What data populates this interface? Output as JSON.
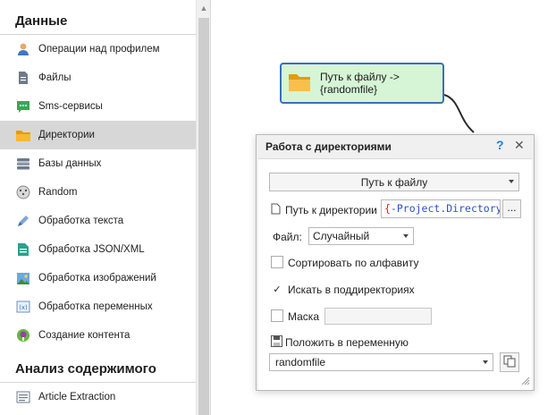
{
  "sidebar": {
    "section_data": "Данные",
    "section_analysis": "Анализ содержимого",
    "items": [
      {
        "label": "Операции над профилем",
        "icon": "user-icon"
      },
      {
        "label": "Файлы",
        "icon": "file-icon"
      },
      {
        "label": "Sms-сервисы",
        "icon": "sms-icon"
      },
      {
        "label": "Директории",
        "icon": "folder-icon",
        "active": true
      },
      {
        "label": "Базы данных",
        "icon": "database-icon"
      },
      {
        "label": "Random",
        "icon": "dice-icon"
      },
      {
        "label": "Обработка текста",
        "icon": "text-processing-icon"
      },
      {
        "label": "Обработка JSON/XML",
        "icon": "json-xml-icon"
      },
      {
        "label": "Обработка изображений",
        "icon": "image-icon"
      },
      {
        "label": "Обработка переменных",
        "icon": "variable-icon"
      },
      {
        "label": "Создание контента",
        "icon": "content-creation-icon"
      }
    ],
    "analysis_items": [
      {
        "label": "Article Extraction",
        "icon": "article-icon"
      }
    ]
  },
  "node": {
    "label": "Путь к файлу ->\n{randomfile}",
    "icon": "folder-icon",
    "fill_color": "#d6f5d6",
    "border_color": "#3b6fb6"
  },
  "dialog": {
    "title": "Работа с директориями",
    "help_glyph": "?",
    "close_glyph": "✕",
    "mode_value": "Путь к файлу",
    "dir_path_label": "Путь к директории",
    "dir_path_value_open": "{",
    "dir_path_value_var": "-Project.Directory",
    "browse_label": "...",
    "file_label": "Файл:",
    "file_value": "Случайный",
    "sort_label": "Сортировать по алфавиту",
    "sort_checked": false,
    "subdirs_label": "Искать в поддиректориях",
    "subdirs_checked": true,
    "mask_label": "Маска",
    "mask_checked": false,
    "mask_value": "",
    "save_to_var_label": "Положить в переменную",
    "var_value": "randomfile",
    "check_glyph": "✓"
  }
}
